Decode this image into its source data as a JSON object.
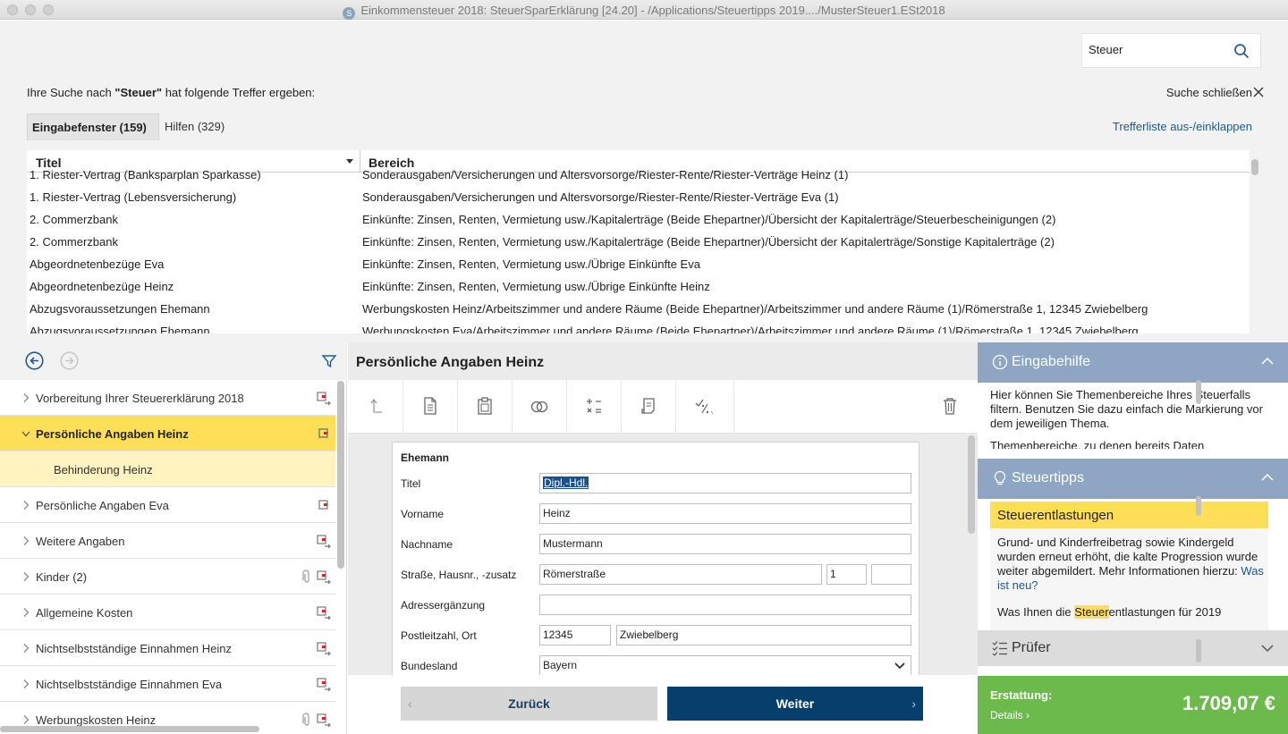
{
  "window": {
    "title": "Einkommensteuer 2018: SteuerSparErklärung [24.20] - /Applications/Steuertipps 2019..../MusterSteuer1.ESt2018"
  },
  "search": {
    "value": "Steuer",
    "result_prefix": "Ihre Suche nach ",
    "result_term": "\"Steuer\"",
    "result_suffix": " hat folgende Treffer ergeben:",
    "close_label": "Suche schließen",
    "tabs": [
      {
        "label": "Eingabefenster (159)"
      },
      {
        "label": "Hilfen (329)"
      }
    ],
    "toggle_label": "Trefferliste aus-/einklappen",
    "columns": [
      "Titel",
      "Bereich"
    ],
    "rows": [
      {
        "title": "1. Riester-Vertrag (Banksparplan Sparkasse)",
        "area": "Sonderausgaben/Versicherungen und Altersvorsorge/Riester-Rente/Riester-Verträge Heinz (1)"
      },
      {
        "title": "1. Riester-Vertrag (Lebensversicherung)",
        "area": "Sonderausgaben/Versicherungen und Altersvorsorge/Riester-Rente/Riester-Verträge Eva (1)"
      },
      {
        "title": "2. Commerzbank",
        "area": "Einkünfte: Zinsen, Renten, Vermietung usw./Kapitalerträge (Beide Ehepartner)/Übersicht der Kapitalerträge/Steuerbescheinigungen (2)"
      },
      {
        "title": "2. Commerzbank",
        "area": "Einkünfte: Zinsen, Renten, Vermietung usw./Kapitalerträge (Beide Ehepartner)/Übersicht der Kapitalerträge/Sonstige Kapitalerträge (2)"
      },
      {
        "title": "Abgeordnetenbezüge Eva",
        "area": "Einkünfte: Zinsen, Renten, Vermietung usw./Übrige Einkünfte Eva"
      },
      {
        "title": "Abgeordnetenbezüge Heinz",
        "area": "Einkünfte: Zinsen, Renten, Vermietung usw./Übrige Einkünfte Heinz"
      },
      {
        "title": "Abzugsvoraussetzungen Ehemann",
        "area": "Werbungskosten Heinz/Arbeitszimmer und andere Räume (Beide Ehepartner)/Arbeitszimmer und andere Räume (1)/Römerstraße 1, 12345 Zwiebelberg"
      },
      {
        "title": "Abzugsvoraussetzungen Ehemann",
        "area": "Werbungskosten Eva/Arbeitszimmer und andere Räume (Beide Ehepartner)/Arbeitszimmer und andere Räume (1)/Römerstraße 1, 12345 Zwiebelberg"
      }
    ]
  },
  "nav": {
    "items": [
      {
        "label": "Vorbereitung Ihrer Steuererklärung 2018",
        "state": "collapsed",
        "icon": "export-icon"
      },
      {
        "label": "Persönliche Angaben Heinz",
        "state": "active",
        "icon": "export-icon"
      },
      {
        "label": "Behinderung Heinz",
        "state": "sub"
      },
      {
        "label": "Persönliche Angaben Eva",
        "state": "collapsed",
        "icon": "export-icon"
      },
      {
        "label": "Weitere Angaben",
        "state": "collapsed",
        "icon": "export-icon"
      },
      {
        "label": "Kinder (2)",
        "state": "collapsed",
        "icon": "export-icon",
        "attachment": true
      },
      {
        "label": "Allgemeine Kosten",
        "state": "collapsed",
        "icon": "export-icon"
      },
      {
        "label": "Nichtselbstständige Einnahmen Heinz",
        "state": "collapsed",
        "icon": "export-icon"
      },
      {
        "label": "Nichtselbstständige Einnahmen Eva",
        "state": "collapsed",
        "icon": "export-icon"
      },
      {
        "label": "Werbungskosten Heinz",
        "state": "collapsed",
        "icon": "export-icon",
        "attachment": true
      }
    ]
  },
  "main": {
    "title": "Persönliche Angaben Heinz",
    "toolbar": [
      "up-arrow-icon",
      "document-icon",
      "clipboard-icon",
      "rings-icon",
      "calculator-icon",
      "receipt-icon",
      "percent-icon",
      "trash-icon"
    ],
    "form": {
      "heading": "Ehemann",
      "fields": {
        "title_label": "Titel",
        "title_value": "Dipl.-Hdl.",
        "first_label": "Vorname",
        "first_value": "Heinz",
        "last_label": "Nachname",
        "last_value": "Mustermann",
        "street_label": "Straße, Hausnr., -zusatz",
        "street_value": "Römerstraße",
        "house_value": "1",
        "suffix_value": "",
        "addr2_label": "Adressergänzung",
        "addr2_value": "",
        "zip_label": "Postleitzahl, Ort",
        "zip_value": "12345",
        "city_value": "Zwiebelberg",
        "state_label": "Bundesland",
        "state_value": "Bayern"
      }
    },
    "buttons": {
      "back": "Zurück",
      "next": "Weiter"
    }
  },
  "right": {
    "help": {
      "title": "Eingabehilfe",
      "text_1": "Hier können Sie Themenbereiche Ihres Steuerfalls filtern. Benutzen Sie dazu einfach die Markierung vor dem jeweiligen Thema.",
      "text_2": "Themenbereiche, zu denen bereits Daten"
    },
    "tips": {
      "title": "Steuertipps",
      "box_title": "Steuerentlastungen",
      "text": "Grund- und Kinderfreibetrag sowie Kindergeld wurden erneut erhöht, die kalte Progression wurde weiter abgemildert. Mehr Informationen hierzu: ",
      "link": "Was ist neu?",
      "text2_a": "Was Ihnen die ",
      "text2_hl": "Steuer",
      "text2_b": "entlastungen für 2019"
    },
    "checker": {
      "title": "Prüfer"
    },
    "refund": {
      "label": "Erstattung:",
      "details": "Details",
      "amount": "1.709,07 €"
    }
  },
  "colors": {
    "accent_yellow": "#ffdf57",
    "panel_blue": "#8ea6c3",
    "next_button": "#073f6c",
    "refund_green": "#6cb94c"
  }
}
